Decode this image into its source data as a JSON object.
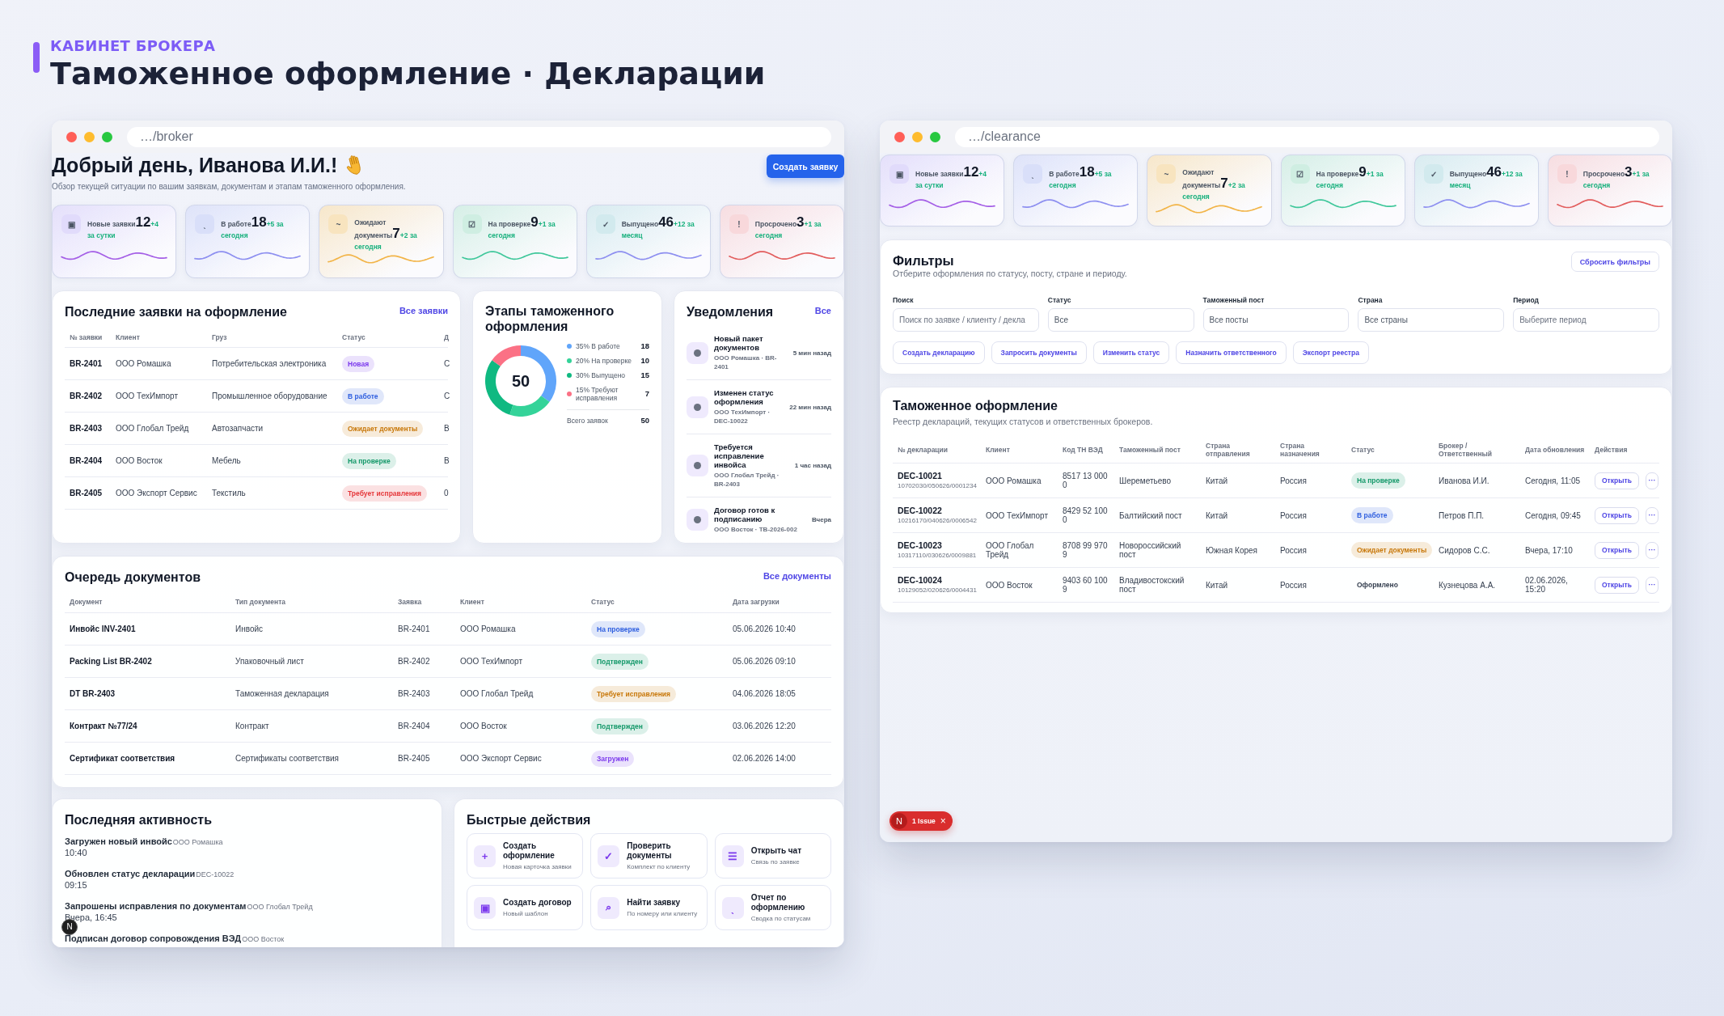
{
  "header": {
    "eyebrow": "КАБИНЕТ БРОКЕРА",
    "title": "Таможенное оформление · Декларации"
  },
  "broker_window": {
    "url": "…/broker",
    "greeting": "Добрый день, Иванова И.И.!",
    "subtitle": "Обзор текущей ситуации по вашим заявкам, документам и этапам таможенного оформления.",
    "primary_button": "Создать заявку",
    "stats": [
      {
        "icon": "▣",
        "label": "Новые заявки",
        "value": "12",
        "delta": "+4 за сутки",
        "color": "#e1dbfb",
        "sparkline": {
          "color": "#a45ee6"
        }
      },
      {
        "icon": "ˎ",
        "label": "В работе",
        "value": "18",
        "delta": "+5 за сегодня",
        "color": "#d9dff9",
        "sparkline": {
          "color": "#8d8ff0"
        }
      },
      {
        "icon": "~",
        "label": "Ожидают документы",
        "value": "7",
        "delta": "+2 за сегодня",
        "color": "#f8e4bf",
        "sparkline": {
          "color": "#f2b447"
        }
      },
      {
        "icon": "☑",
        "label": "На проверке",
        "value": "9",
        "delta": "+1 за сегодня",
        "color": "#cfeee2",
        "sparkline": {
          "color": "#3ec79a"
        }
      },
      {
        "icon": "✓",
        "label": "Выпущено",
        "value": "46",
        "delta": "+12 за месяц",
        "color": "#d2eaee",
        "sparkline": {
          "color": "#8d8ff0"
        }
      },
      {
        "icon": "!",
        "label": "Просрочено",
        "value": "3",
        "delta": "+1 за сегодня",
        "color": "#f8d8db",
        "sparkline": {
          "color": "#e25c5c"
        }
      }
    ],
    "recent_orders": {
      "title": "Последние заявки на оформление",
      "link": "Все заявки",
      "columns": [
        "№ заявки",
        "Клиент",
        "Груз",
        "Статус",
        "Д"
      ],
      "rows": [
        {
          "id": "BR-2401",
          "client": "ООО Ромашка",
          "cargo": "Потребительская электроника",
          "status": {
            "label": "Новая",
            "color": "#7c3aed"
          },
          "date": "С"
        },
        {
          "id": "BR-2402",
          "client": "ООО ТехИмпорт",
          "cargo": "Промышленное оборудование",
          "status": {
            "label": "В работе",
            "color": "#2f5fdf"
          },
          "date": "С"
        },
        {
          "id": "BR-2403",
          "client": "ООО Глобал Трейд",
          "cargo": "Автозапчасти",
          "status": {
            "label": "Ожидает документы",
            "color": "#c8780a"
          },
          "date": "В"
        },
        {
          "id": "BR-2404",
          "client": "ООО Восток",
          "cargo": "Мебель",
          "status": {
            "label": "На проверке",
            "color": "#15996a"
          },
          "date": "В"
        },
        {
          "id": "BR-2405",
          "client": "ООО Экспорт Сервис",
          "cargo": "Текстиль",
          "status": {
            "label": "Требует исправления",
            "color": "#e5383b"
          },
          "date": "0"
        }
      ]
    },
    "stages": {
      "title": "Этапы таможенного оформления",
      "chart_data": {
        "type": "donut",
        "values": [
          35,
          20,
          30,
          15
        ]
      },
      "center_label": "50",
      "legend": [
        {
          "label": "35% В работе",
          "count": "18",
          "color": "#60a5fa"
        },
        {
          "label": "20% На проверке",
          "count": "10",
          "color": "#34d399"
        },
        {
          "label": "30% Выпущено",
          "count": "15",
          "color": "#10b981"
        },
        {
          "label": "15% Требуют исправления",
          "count": "7",
          "color": "#fb7185"
        }
      ],
      "total_label": "Всего заявок",
      "total": "50"
    },
    "notifications": {
      "title": "Уведомления",
      "link": "Все",
      "items": [
        {
          "title": "Новый пакет документов",
          "subtitle": "ООО Ромашка · BR-2401",
          "time": "5 мин назад"
        },
        {
          "title": "Изменен статус оформления",
          "subtitle": "ООО ТехИмпорт · DEC-10022",
          "time": "22 мин назад"
        },
        {
          "title": "Требуется исправление инвойса",
          "subtitle": "ООО Глобал Трейд · BR-2403",
          "time": "1 час назад"
        },
        {
          "title": "Договор готов к подписанию",
          "subtitle": "ООО Восток · TB-2026-002",
          "time": "Вчера"
        }
      ]
    },
    "documents": {
      "title": "Очередь документов",
      "link": "Все документы",
      "columns": [
        "Документ",
        "Тип документа",
        "Заявка",
        "Клиент",
        "Статус",
        "Дата загрузки"
      ],
      "rows": [
        {
          "document": "Инвойс INV-2401",
          "type": "Инвойс",
          "order": "BR-2401",
          "client": "ООО Ромашка",
          "status": {
            "label": "На проверке",
            "color": "#2f5fdf"
          },
          "date": "05.06.2026 10:40"
        },
        {
          "document": "Packing List BR-2402",
          "type": "Упаковочный лист",
          "order": "BR-2402",
          "client": "ООО ТехИмпорт",
          "status": {
            "label": "Подтвержден",
            "color": "#15996a"
          },
          "date": "05.06.2026 09:10"
        },
        {
          "document": "DT BR-2403",
          "type": "Таможенная декларация",
          "order": "BR-2403",
          "client": "ООО Глобал Трейд",
          "status": {
            "label": "Требует исправления",
            "color": "#c8780a"
          },
          "date": "04.06.2026 18:05"
        },
        {
          "document": "Контракт №77/24",
          "type": "Контракт",
          "order": "BR-2404",
          "client": "ООО Восток",
          "status": {
            "label": "Подтвержден",
            "color": "#15996a"
          },
          "date": "03.06.2026 12:20"
        },
        {
          "document": "Сертификат соответствия",
          "type": "Сертификаты соответствия",
          "order": "BR-2405",
          "client": "ООО Экспорт Сервис",
          "status": {
            "label": "Загружен",
            "color": "#7c3aed"
          },
          "date": "02.06.2026 14:00"
        }
      ]
    },
    "activity": {
      "title": "Последняя активность",
      "items": [
        {
          "title": "Загружен новый инвойс",
          "detail": "ООО Ромашка",
          "time": "10:40"
        },
        {
          "title": "Обновлен статус декларации",
          "detail": "DEC-10022",
          "time": "09:15"
        },
        {
          "title": "Запрошены исправления по документам",
          "detail": "ООО Глобал Трейд",
          "time": "Вчера, 16:45"
        },
        {
          "title": "Подписан договор сопровождения ВЭД",
          "detail": "ООО Восток"
        }
      ]
    },
    "quick_actions": {
      "title": "Быстрые действия",
      "items": [
        {
          "icon": "+",
          "title": "Создать оформление",
          "subtitle": "Новая карточка заявки"
        },
        {
          "icon": "✓",
          "title": "Проверить документы",
          "subtitle": "Комплект по клиенту"
        },
        {
          "icon": "☰",
          "title": "Открыть чат",
          "subtitle": "Связь по заявке"
        },
        {
          "icon": "▣",
          "title": "Создать договор",
          "subtitle": "Новый шаблон"
        },
        {
          "icon": "⌕",
          "title": "Найти заявку",
          "subtitle": "По номеру или клиенту"
        },
        {
          "icon": "ˎ",
          "title": "Отчет по оформлению",
          "subtitle": "Сводка по статусам"
        }
      ]
    },
    "dev_badge": "N"
  },
  "clearance_window": {
    "url": "…/clearance",
    "stats": [
      {
        "icon": "▣",
        "label": "Новые заявки",
        "value": "12",
        "delta": "+4 за сутки",
        "color": "#e1dbfb",
        "sparkline": {
          "color": "#a45ee6"
        }
      },
      {
        "icon": "ˎ",
        "label": "В работе",
        "value": "18",
        "delta": "+5 за сегодня",
        "color": "#d9dff9",
        "sparkline": {
          "color": "#8d8ff0"
        }
      },
      {
        "icon": "~",
        "label": "Ожидают документы",
        "value": "7",
        "delta": "+2 за сегодня",
        "color": "#f8e4bf",
        "sparkline": {
          "color": "#f2b447"
        }
      },
      {
        "icon": "☑",
        "label": "На проверке",
        "value": "9",
        "delta": "+1 за сегодня",
        "color": "#cfeee2",
        "sparkline": {
          "color": "#3ec79a"
        }
      },
      {
        "icon": "✓",
        "label": "Выпущено",
        "value": "46",
        "delta": "+12 за месяц",
        "color": "#d2eaee",
        "sparkline": {
          "color": "#8d8ff0"
        }
      },
      {
        "icon": "!",
        "label": "Просрочено",
        "value": "3",
        "delta": "+1 за сегодня",
        "color": "#f8d8db",
        "sparkline": {
          "color": "#e25c5c"
        }
      }
    ],
    "filters": {
      "title": "Фильтры",
      "subtitle": "Отберите оформления по статусу, посту, стране и периоду.",
      "reset_button": "Сбросить фильтры",
      "fields": [
        {
          "label": "Поиск",
          "placeholder": "Поиск по заявке / клиенту / декла"
        },
        {
          "label": "Статус",
          "value": "Все"
        },
        {
          "label": "Таможенный пост",
          "value": "Все посты"
        },
        {
          "label": "Страна",
          "value": "Все страны"
        },
        {
          "label": "Период",
          "placeholder": "Выберите период"
        }
      ],
      "actions": [
        "Создать декларацию",
        "Запросить документы",
        "Изменить статус",
        "Назначить ответственного",
        "Экспорт реестра"
      ]
    },
    "registry": {
      "title": "Таможенное оформление",
      "subtitle": "Реестр деклараций, текущих статусов и ответственных брокеров.",
      "columns": [
        "№ декларации",
        "Клиент",
        "Код ТН ВЭД",
        "Таможенный пост",
        "Страна отправления",
        "Страна назначения",
        "Статус",
        "Брокер / Ответственный",
        "Дата обновления",
        "Действия"
      ],
      "rows": [
        {
          "number": "DEC-10021",
          "code": "10702030/050626/0001234",
          "client": "ООО Ромашка",
          "hs_code": "8517 13 000 0",
          "post": "Шереметьево",
          "origin": "Китай",
          "destination": "Россия",
          "status": {
            "label": "На проверке",
            "color": "#15996a",
            "kind": "pill"
          },
          "broker": "Иванова И.И.",
          "updated": "Сегодня, 11:05",
          "open_button": "Открыть",
          "more_button": "···"
        },
        {
          "number": "DEC-10022",
          "code": "10216170/040626/0006542",
          "client": "ООО ТехИмпорт",
          "hs_code": "8429 52 100 0",
          "post": "Балтийский пост",
          "origin": "Китай",
          "destination": "Россия",
          "status": {
            "label": "В работе",
            "color": "#2f5fdf",
            "kind": "pill"
          },
          "broker": "Петров П.П.",
          "updated": "Сегодня, 09:45",
          "open_button": "Открыть",
          "more_button": "···"
        },
        {
          "number": "DEC-10023",
          "code": "10317110/030626/0009881",
          "client": "ООО Глобал Трейд",
          "hs_code": "8708 99 970 9",
          "post": "Новороссийский пост",
          "origin": "Южная Корея",
          "destination": "Россия",
          "status": {
            "label": "Ожидает документы",
            "color": "#c8780a",
            "kind": "pill"
          },
          "broker": "Сидоров С.С.",
          "updated": "Вчера, 17:10",
          "open_button": "Открыть",
          "more_button": "···"
        },
        {
          "number": "DEC-10024",
          "code": "10129052/020626/0004431",
          "client": "ООО Восток",
          "hs_code": "9403 60 100 9",
          "post": "Владивостокский пост",
          "origin": "Китай",
          "destination": "Россия",
          "status": {
            "label": "Оформлено",
            "color": "#374151",
            "kind": "plain"
          },
          "broker": "Кузнецова А.А.",
          "updated": "02.06.2026, 15:20",
          "open_button": "Открыть",
          "more_button": "···"
        }
      ]
    },
    "issue_badge": {
      "logo": "N",
      "label": "1 Issue",
      "close": "×"
    }
  }
}
